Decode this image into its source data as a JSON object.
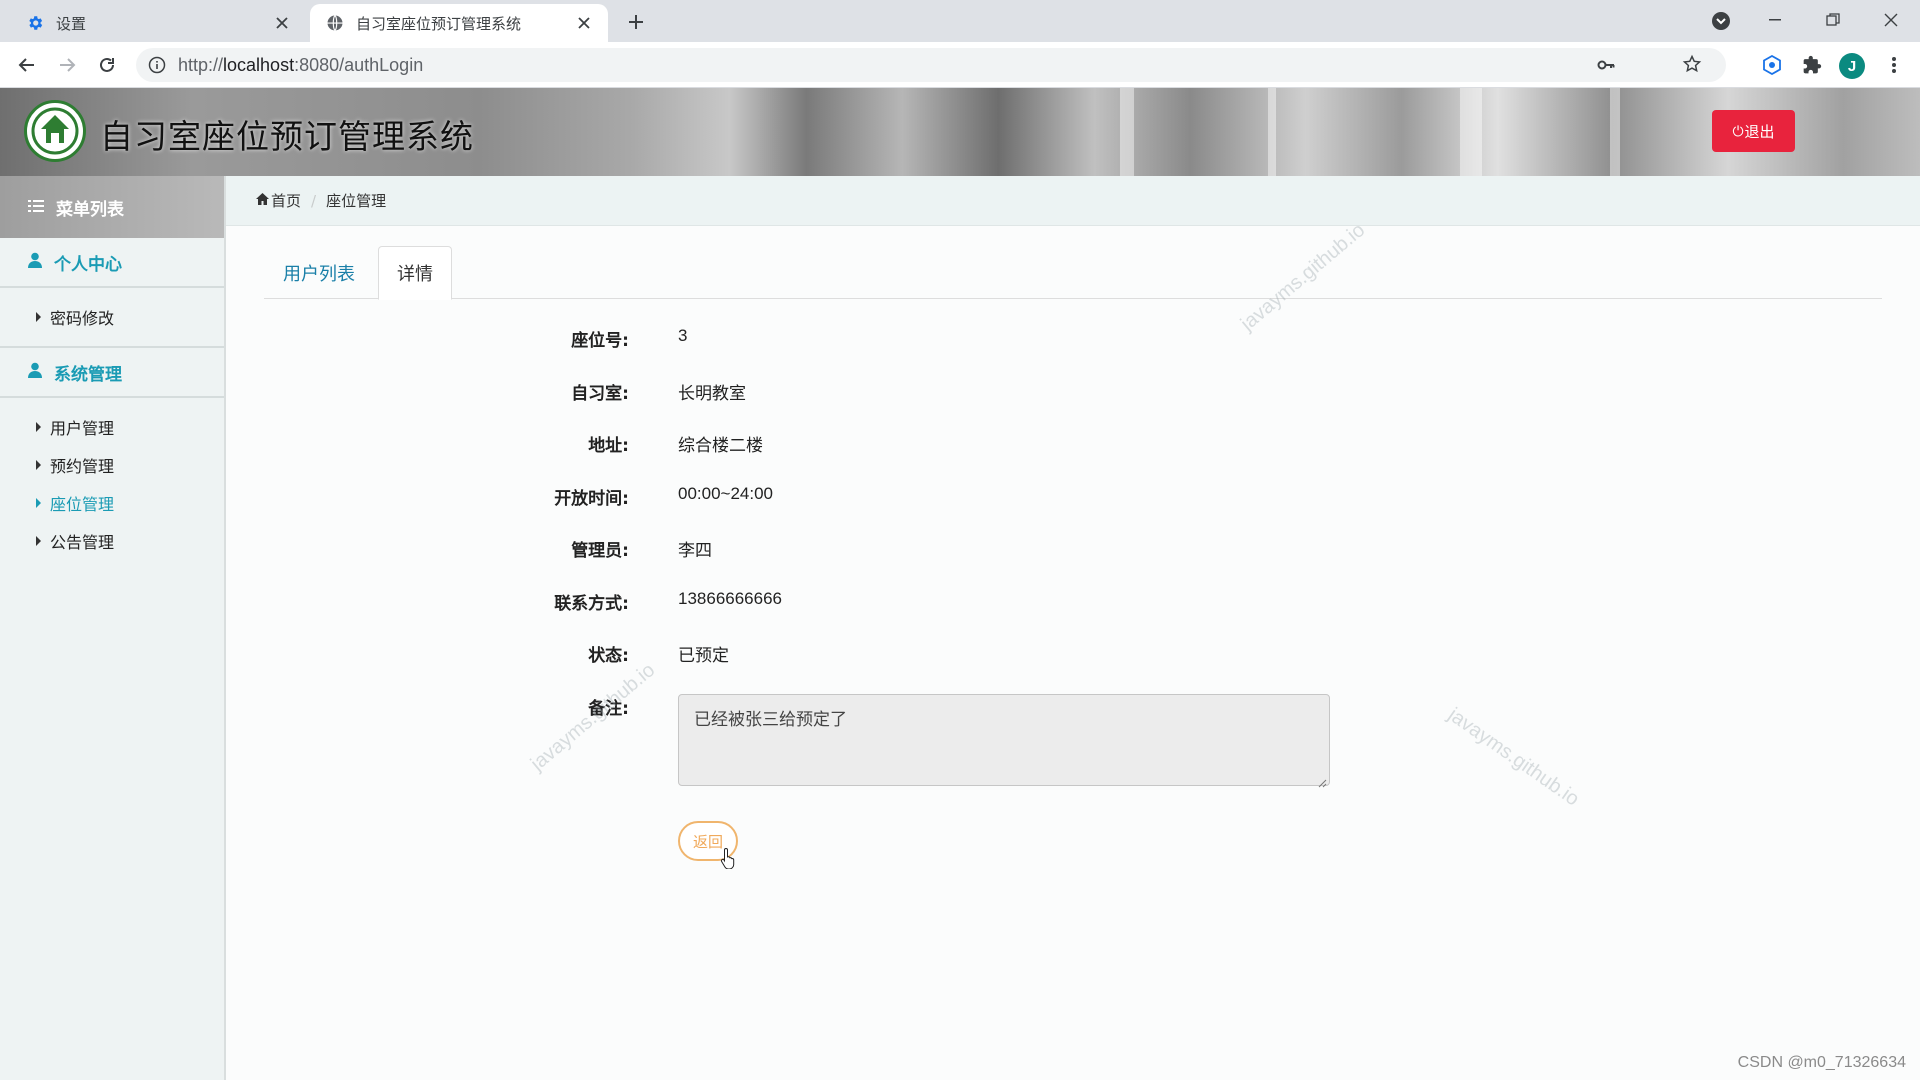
{
  "browser": {
    "tabs": [
      {
        "title": "设置",
        "icon": "gear-icon",
        "active": false
      },
      {
        "title": "自习室座位预订管理系统",
        "icon": "globe-icon",
        "active": true
      }
    ],
    "url_scheme": "http://",
    "url_host": "localhost",
    "url_path": ":8080/authLogin",
    "avatar_letter": "J"
  },
  "header": {
    "title": "自习室座位预订管理系统",
    "logout_label": "退出",
    "accent": "#e8233d"
  },
  "sidebar": {
    "menu_title": "菜单列表",
    "groups": [
      {
        "label": "个人中心",
        "items": [
          {
            "label": "密码修改",
            "active": false
          }
        ]
      },
      {
        "label": "系统管理",
        "items": [
          {
            "label": "用户管理",
            "active": false
          },
          {
            "label": "预约管理",
            "active": false
          },
          {
            "label": "座位管理",
            "active": true
          },
          {
            "label": "公告管理",
            "active": false
          }
        ]
      }
    ],
    "accent": "#1a9bb4"
  },
  "breadcrumb": {
    "home": "首页",
    "current": "座位管理"
  },
  "tabs": [
    {
      "label": "用户列表",
      "active": false
    },
    {
      "label": "详情",
      "active": true
    }
  ],
  "detail": {
    "fields": [
      {
        "label": "座位号:",
        "value": "3"
      },
      {
        "label": "自习室:",
        "value": "长明教室"
      },
      {
        "label": "地址:",
        "value": "综合楼二楼"
      },
      {
        "label": "开放时间:",
        "value": "00:00~24:00"
      },
      {
        "label": "管理员:",
        "value": "李四"
      },
      {
        "label": "联系方式:",
        "value": "13866666666"
      },
      {
        "label": "状态:",
        "value": "已预定"
      }
    ],
    "remark_label": "备注:",
    "remark_value": "已经被张三给预定了",
    "back_label": "返回"
  },
  "watermarks": [
    "javayms.github.io"
  ],
  "footer_credit": "CSDN @m0_71326634"
}
